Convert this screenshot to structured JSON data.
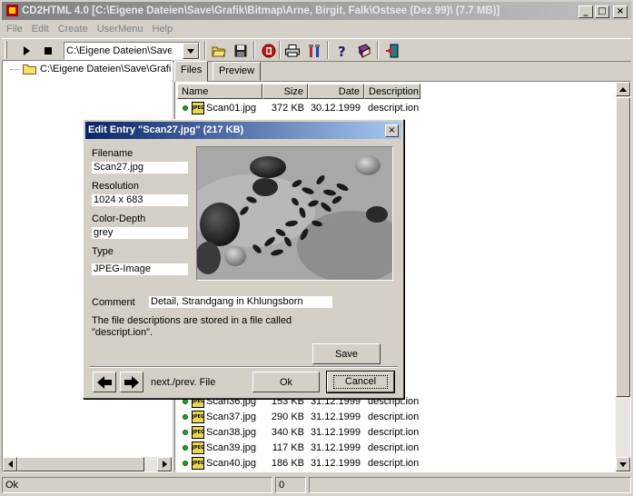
{
  "window": {
    "title": "CD2HTML 4.0 [C:\\Eigene Dateien\\Save\\Grafik\\Bitmap\\Arne, Birgit, Falk\\Ostsee (Dez 99)\\ (7.7 MB)]",
    "min_glyph": "_",
    "max_glyph": "□",
    "close_glyph": "×"
  },
  "menu": [
    "File",
    "Edit",
    "Create",
    "UserMenu",
    "Help"
  ],
  "toolbar": {
    "path_value": "C:\\Eigene Dateien\\Save\\Grafik\\Bitmap",
    "icons": [
      "play-icon",
      "stop-icon",
      "open-folder-icon",
      "save-disk-icon",
      "stop-sign-icon",
      "print-icon",
      "tools-icon",
      "help-icon",
      "book-icon",
      "exit-door-icon"
    ]
  },
  "tree": {
    "root_label": "C:\\Eigene Dateien\\Save\\Grafik\\Bitmap"
  },
  "tabs": [
    "Files",
    "Preview"
  ],
  "list": {
    "columns": [
      "Name",
      "Size",
      "Date",
      "Description"
    ],
    "rows": [
      {
        "name": "Scan01.jpg",
        "size": "372 KB",
        "date": "30.12.1999",
        "desc": "descript.ion"
      },
      {
        "name": "",
        "size": "",
        "date": "",
        "desc": "ion"
      },
      {
        "name": "",
        "size": "",
        "date": "",
        "desc": "ion"
      },
      {
        "name": "",
        "size": "",
        "date": "",
        "desc": "ion"
      },
      {
        "name": "",
        "size": "",
        "date": "",
        "desc": "ion"
      },
      {
        "name": "",
        "size": "",
        "date": "",
        "desc": "ion"
      },
      {
        "name": "",
        "size": "",
        "date": "",
        "desc": "ion"
      },
      {
        "name": "",
        "size": "",
        "date": "",
        "desc": "ion"
      },
      {
        "name": "",
        "size": "",
        "date": "",
        "desc": "ion"
      },
      {
        "name": "",
        "size": "",
        "date": "",
        "desc": "ion"
      },
      {
        "name": "",
        "size": "",
        "date": "",
        "desc": "ion"
      },
      {
        "name": "",
        "size": "",
        "date": "",
        "desc": "ion"
      },
      {
        "name": "",
        "size": "",
        "date": "",
        "desc": "ion"
      },
      {
        "name": "",
        "size": "",
        "date": "",
        "desc": "ion"
      },
      {
        "name": "",
        "size": "",
        "date": "",
        "desc": "ion"
      },
      {
        "name": "",
        "size": "",
        "date": "",
        "desc": "ion"
      },
      {
        "name": "",
        "size": "",
        "date": "",
        "desc": "ion"
      },
      {
        "name": "",
        "size": "",
        "date": "",
        "desc": "ion"
      },
      {
        "name": "",
        "size": "",
        "date": "",
        "desc": "ion"
      },
      {
        "name": "Scan36.jpg",
        "size": "153 KB",
        "date": "31.12.1999",
        "desc": "descript.ion"
      },
      {
        "name": "Scan37.jpg",
        "size": "290 KB",
        "date": "31.12.1999",
        "desc": "descript.ion"
      },
      {
        "name": "Scan38.jpg",
        "size": "340 KB",
        "date": "31.12.1999",
        "desc": "descript.ion"
      },
      {
        "name": "Scan39.jpg",
        "size": "117 KB",
        "date": "31.12.1999",
        "desc": "descript.ion"
      },
      {
        "name": "Scan40.jpg",
        "size": "186 KB",
        "date": "31.12.1999",
        "desc": "descript.ion"
      }
    ]
  },
  "status": {
    "left": "Ok",
    "mid": "0",
    "right": ""
  },
  "dialog": {
    "title": "Edit Entry \"Scan27.jpg\" (217 KB)",
    "filename_label": "Filename",
    "filename_value": "Scan27.jpg",
    "resolution_label": "Resolution",
    "resolution_value": "1024 x 683",
    "color_depth_label": "Color-Depth",
    "color_depth_value": "grey",
    "type_label": "Type",
    "type_value": "JPEG-Image",
    "comment_label": "Comment",
    "comment_value": "Detail, Strandgang in Khlungsborn",
    "info_text": "The file descriptions are stored in a file called \"descript.ion\".",
    "save_label": "Save",
    "nav_label": "next./prev. File",
    "ok_label": "Ok",
    "cancel_label": "Cancel"
  },
  "colors": {
    "dialog_title_start": "#0a246a",
    "dialog_title_end": "#a6caf0",
    "face": "#d4d0c8"
  }
}
